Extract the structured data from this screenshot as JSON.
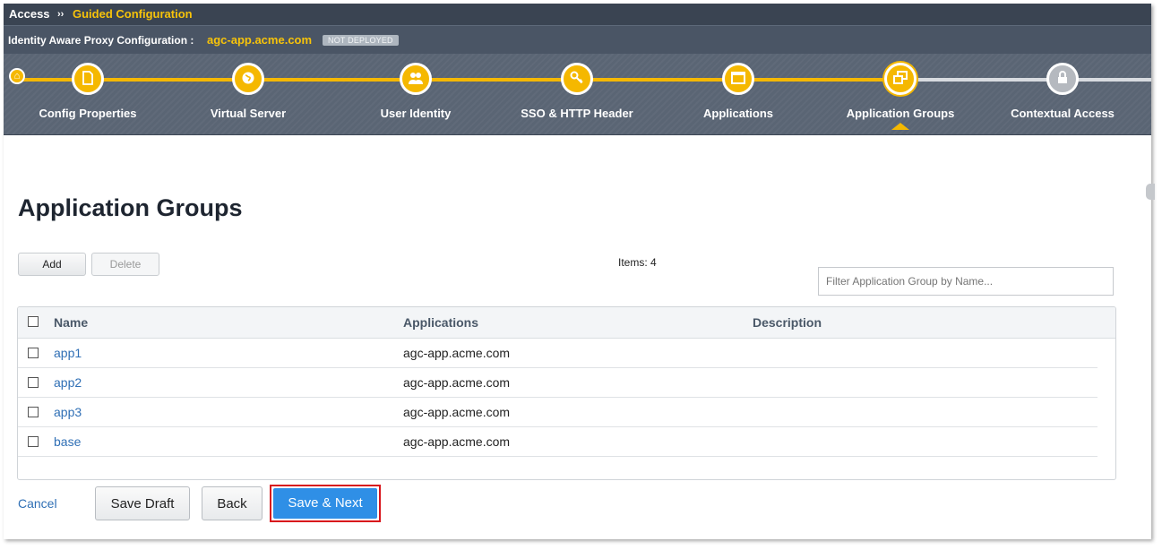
{
  "breadcrumb": {
    "section": "Access",
    "separator": "››",
    "page": "Guided Configuration"
  },
  "config": {
    "label": "Identity Aware Proxy Configuration :",
    "app_name": "agc-app.acme.com",
    "status_badge": "NOT DEPLOYED"
  },
  "wizard": {
    "active_step": "Application Groups",
    "steps": [
      {
        "label": "Config Properties",
        "icon": "document-icon",
        "state": "complete"
      },
      {
        "label": "Virtual Server",
        "icon": "globe-icon",
        "state": "complete"
      },
      {
        "label": "User Identity",
        "icon": "users-icon",
        "state": "complete"
      },
      {
        "label": "SSO & HTTP Header",
        "icon": "key-icon",
        "state": "complete"
      },
      {
        "label": "Applications",
        "icon": "window-icon",
        "state": "complete"
      },
      {
        "label": "Application Groups",
        "icon": "windows-group-icon",
        "state": "active"
      },
      {
        "label": "Contextual Access",
        "icon": "lock-icon",
        "state": "incomplete"
      }
    ]
  },
  "main": {
    "title": "Application Groups",
    "add_label": "Add",
    "delete_label": "Delete",
    "items_count": "Items: 4",
    "filter_placeholder": "Filter Application Group by Name..."
  },
  "table": {
    "headers": [
      "Name",
      "Applications",
      "Description"
    ],
    "rows": [
      {
        "name": "app1",
        "applications": "agc-app.acme.com",
        "description": ""
      },
      {
        "name": "app2",
        "applications": "agc-app.acme.com",
        "description": ""
      },
      {
        "name": "app3",
        "applications": "agc-app.acme.com",
        "description": ""
      },
      {
        "name": "base",
        "applications": "agc-app.acme.com",
        "description": ""
      }
    ]
  },
  "footer": {
    "cancel": "Cancel",
    "save_draft": "Save Draft",
    "back": "Back",
    "save_next": "Save & Next"
  },
  "colors": {
    "accent": "#f5b800",
    "primary_button": "#2f8fe6",
    "highlight_border": "#d8151c",
    "link": "#2f6fb5"
  }
}
